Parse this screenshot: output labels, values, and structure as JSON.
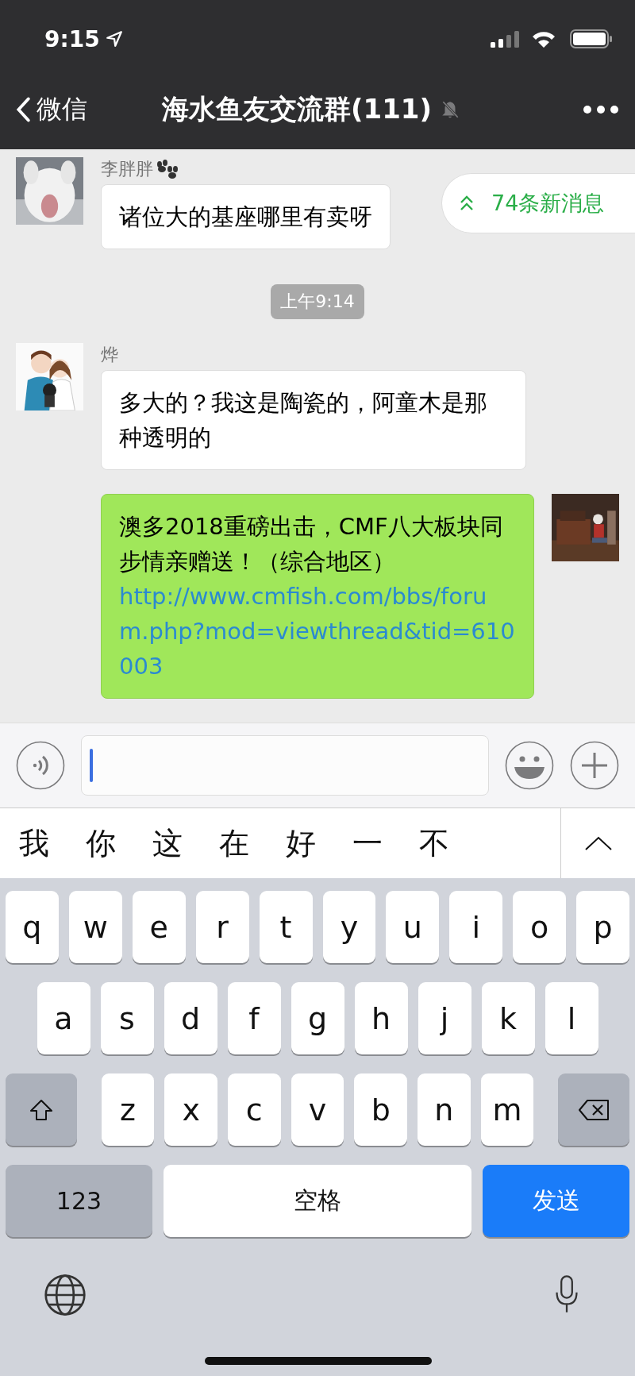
{
  "status_bar": {
    "time": "9:15"
  },
  "nav": {
    "back_label": "微信",
    "title": "海水鱼友交流群(111)",
    "muted": true
  },
  "new_messages": {
    "label": "74条新消息"
  },
  "messages": [
    {
      "kind": "incoming",
      "sender": "李胖胖",
      "text": "诸位大的基座哪里有卖呀"
    },
    {
      "kind": "timestamp",
      "text": "上午9:14"
    },
    {
      "kind": "incoming",
      "sender": "烨",
      "text": "多大的？我这是陶瓷的，阿童木是那种透明的"
    },
    {
      "kind": "outgoing",
      "text": "澳多2018重磅出击，CMF八大板块同步情亲赠送！（综合地区）",
      "link": "http://www.cmfish.com/bbs/forum.php?mod=viewthread&tid=610003"
    }
  ],
  "candidates": [
    "我",
    "你",
    "这",
    "在",
    "好",
    "一",
    "不"
  ],
  "keyboard": {
    "rows": [
      [
        "q",
        "w",
        "e",
        "r",
        "t",
        "y",
        "u",
        "i",
        "o",
        "p"
      ],
      [
        "a",
        "s",
        "d",
        "f",
        "g",
        "h",
        "j",
        "k",
        "l"
      ],
      [
        "z",
        "x",
        "c",
        "v",
        "b",
        "n",
        "m"
      ]
    ],
    "numbers_key": "123",
    "space_key": "空格",
    "send_key": "发送"
  }
}
